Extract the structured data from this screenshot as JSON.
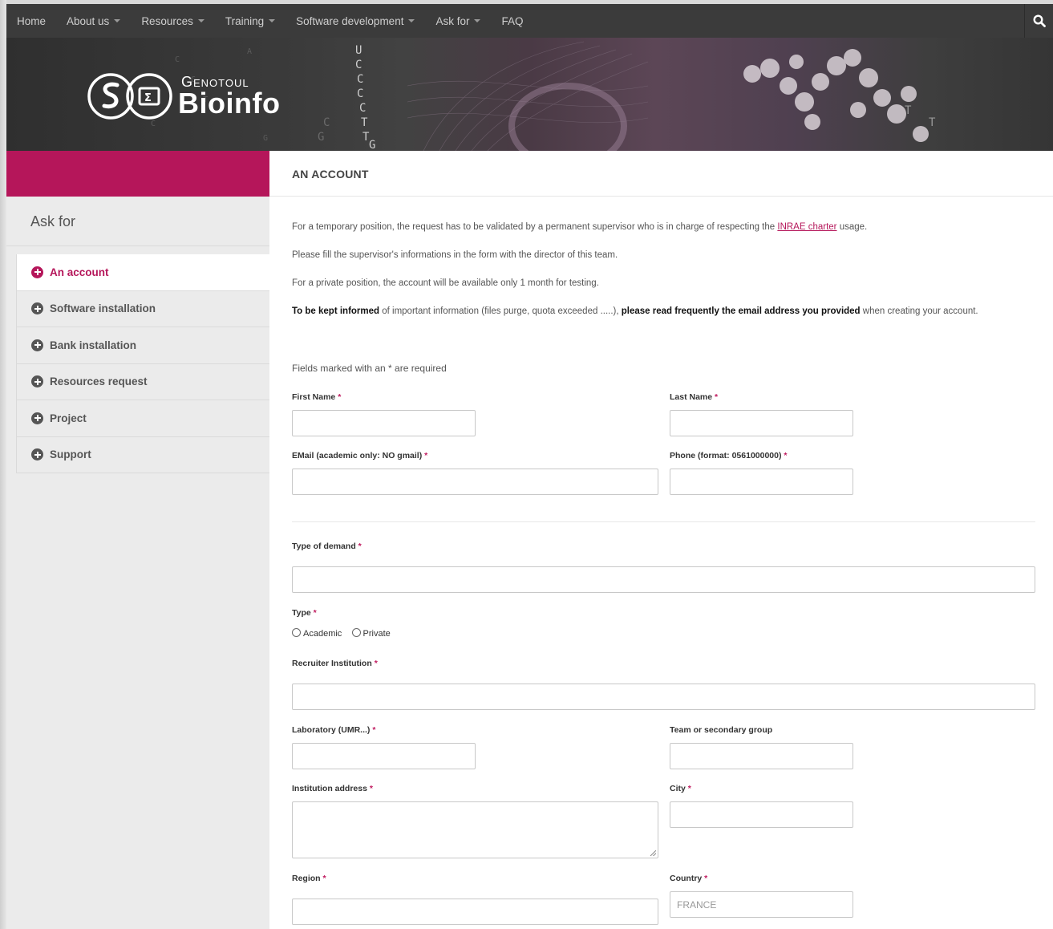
{
  "nav": {
    "items": [
      {
        "label": "Home",
        "dropdown": false
      },
      {
        "label": "About us",
        "dropdown": true
      },
      {
        "label": "Resources",
        "dropdown": true
      },
      {
        "label": "Training",
        "dropdown": true
      },
      {
        "label": "Software development",
        "dropdown": true
      },
      {
        "label": "Ask for",
        "dropdown": true
      },
      {
        "label": "FAQ",
        "dropdown": false
      }
    ],
    "search_icon": "search-icon"
  },
  "banner": {
    "logo_small": "Genotoul",
    "logo_big": "Bioinfo"
  },
  "sidebar": {
    "title": "Ask for",
    "items": [
      {
        "label": "An account",
        "active": true
      },
      {
        "label": "Software installation",
        "active": false
      },
      {
        "label": "Bank installation",
        "active": false
      },
      {
        "label": "Resources request",
        "active": false
      },
      {
        "label": "Project",
        "active": false
      },
      {
        "label": "Support",
        "active": false
      }
    ]
  },
  "main": {
    "title": "AN ACCOUNT",
    "intro": {
      "p1_before": "For a temporary position, the request has to be validated by a permanent supervisor who is in charge of respecting the ",
      "p1_link": "INRAE charter",
      "p1_after": " usage.",
      "p2": "Please fill the supervisor's informations in the form with the director of this team.",
      "p3": "For a private position, the account will be available only 1 month for testing.",
      "p4_b1": "To be kept informed",
      "p4_mid": " of important information (files purge, quota exceeded .....), ",
      "p4_b2": "please read frequently the email address you provided",
      "p4_after": " when creating your account."
    },
    "required_note": "Fields marked with an * are required",
    "required_star": "*",
    "form": {
      "first_name": "First Name",
      "last_name": "Last Name",
      "email": "EMail (academic only: NO gmail)",
      "phone": "Phone (format: 0561000000)",
      "type_of_demand": "Type of demand",
      "type": "Type",
      "type_options": [
        "Academic",
        "Private"
      ],
      "recruiter": "Recruiter Institution",
      "laboratory": "Laboratory (UMR...)",
      "team": "Team or secondary group",
      "institution_address": "Institution address",
      "city": "City",
      "region": "Region",
      "country": "Country",
      "country_placeholder": "FRANCE"
    }
  },
  "colors": {
    "accent": "#b5165a",
    "nav_bg": "#3b3b3b",
    "sidebar_bg": "#ebebeb"
  }
}
